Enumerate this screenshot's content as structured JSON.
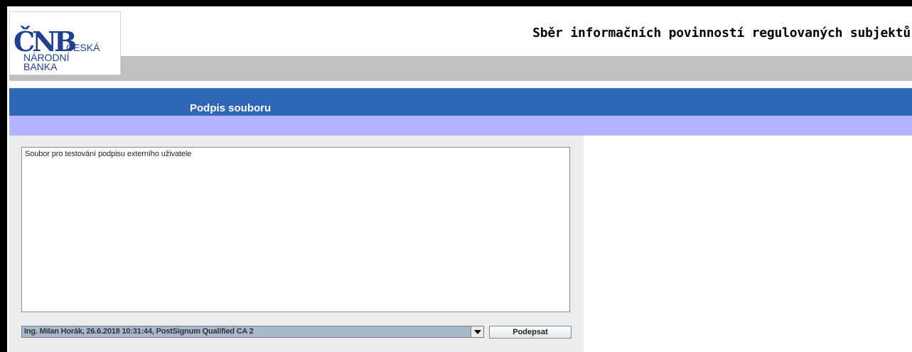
{
  "header": {
    "logo": {
      "mark": "ČNB",
      "line1": "ČESKÁ",
      "line2": "NÁRODNÍ",
      "line3": "BANKA"
    },
    "app_title": "Sběr informačních povinností regulovaných subjektů"
  },
  "section": {
    "title": "Podpis souboru"
  },
  "form": {
    "file_description": "Soubor pro testování podpisu externího uživatele",
    "certificate_selected": "Ing. Milan Horák, 26.6.2018 10:31:44, PostSignum Qualified CA 2",
    "sign_button_label": "Podepsat"
  },
  "colors": {
    "blue_band": "#2f67b7",
    "lilac_band": "#b3b3ff",
    "gray_bar": "#c0c0c0",
    "logo_blue": "#1f3f8f"
  }
}
